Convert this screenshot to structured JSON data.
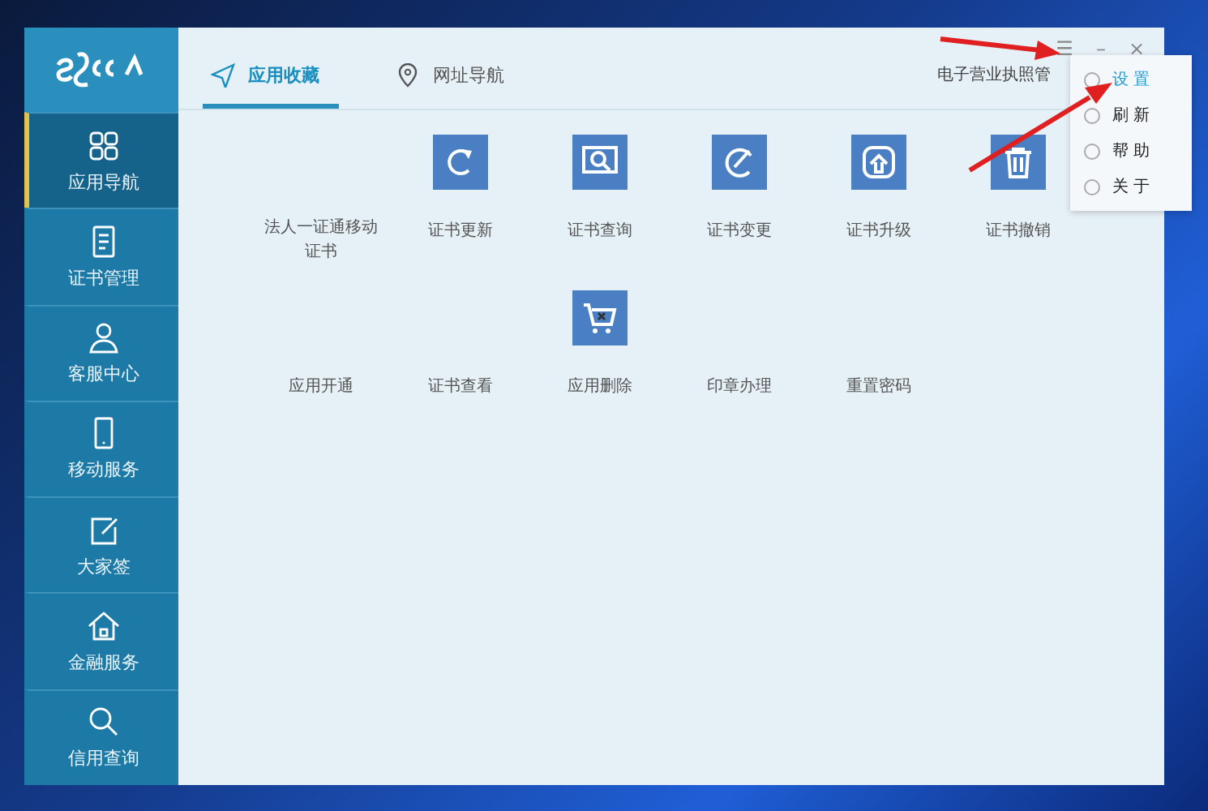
{
  "sidebar": {
    "items": [
      {
        "label": "应用导航",
        "selected": true
      },
      {
        "label": "证书管理",
        "selected": false
      },
      {
        "label": "客服中心",
        "selected": false
      },
      {
        "label": "移动服务",
        "selected": false
      },
      {
        "label": "大家签",
        "selected": false
      },
      {
        "label": "金融服务",
        "selected": false
      },
      {
        "label": "信用查询",
        "selected": false
      }
    ]
  },
  "tabs": [
    {
      "label": "应用收藏",
      "selected": true
    },
    {
      "label": "网址导航",
      "selected": false
    }
  ],
  "header_text": "电子营业执照管",
  "window_controls": [
    "☰",
    "–",
    "×"
  ],
  "apps": [
    [
      {
        "label": "法人一证通移动证书",
        "kind": "plain"
      },
      {
        "label": "证书更新",
        "kind": "tile"
      },
      {
        "label": "证书查询",
        "kind": "tile"
      },
      {
        "label": "证书变更",
        "kind": "tile"
      },
      {
        "label": "证书升级",
        "kind": "tile"
      },
      {
        "label": "证书撤销",
        "kind": "tile"
      }
    ],
    [
      {
        "label": "应用开通",
        "kind": "plain"
      },
      {
        "label": "证书查看",
        "kind": "plain"
      },
      {
        "label": "应用删除",
        "kind": "tile"
      },
      {
        "label": "印章办理",
        "kind": "plain"
      },
      {
        "label": "重置密码",
        "kind": "plain"
      }
    ]
  ],
  "menu": {
    "items": [
      {
        "label": "设 置",
        "selected": true
      },
      {
        "label": "刷 新",
        "selected": false
      },
      {
        "label": "帮 助",
        "selected": false
      },
      {
        "label": "关 于",
        "selected": false
      }
    ]
  }
}
